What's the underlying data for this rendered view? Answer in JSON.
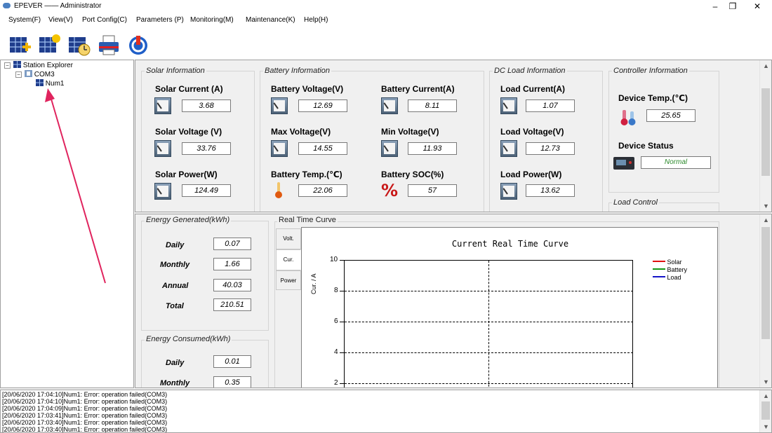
{
  "window": {
    "title": "EPEVER —— Administrator",
    "minimize": "–",
    "restore": "❐",
    "close": "✕"
  },
  "menu": [
    "System(F)",
    "View(V)",
    "Port Config(C)",
    "Parameters (P)",
    "Monitoring(M)",
    "Maintenance(K)",
    "Help(H)"
  ],
  "toolbar": {
    "icons": [
      "add-station-icon",
      "solar-panel-icon",
      "schedule-icon",
      "printer-icon",
      "power-icon"
    ]
  },
  "tree": {
    "root": "Station Explorer",
    "port": "COM3",
    "device": "Num1"
  },
  "solar": {
    "title": "Solar Information",
    "current_label": "Solar Current (A)",
    "current": "3.68",
    "voltage_label": "Solar Voltage (V)",
    "voltage": "33.76",
    "power_label": "Solar Power(W)",
    "power": "124.49"
  },
  "battery": {
    "title": "Battery Information",
    "voltage_label": "Battery Voltage(V)",
    "voltage": "12.69",
    "current_label": "Battery Current(A)",
    "current": "8.11",
    "max_label": "Max Voltage(V)",
    "max": "14.55",
    "min_label": "Min Voltage(V)",
    "min": "11.93",
    "temp_label": "Battery Temp.(℃)",
    "temp": "22.06",
    "soc_label": "Battery SOC(%)",
    "soc": "57"
  },
  "load": {
    "title": "DC Load Information",
    "current_label": "Load Current(A)",
    "current": "1.07",
    "voltage_label": "Load Voltage(V)",
    "voltage": "12.73",
    "power_label": "Load Power(W)",
    "power": "13.62"
  },
  "controller": {
    "title": "Controller Information",
    "temp_label": "Device Temp.(℃)",
    "temp": "25.65",
    "status_label": "Device Status",
    "status": "Normal",
    "status_color": "#2e8b2e",
    "load_control_title": "Load Control"
  },
  "energy_generated": {
    "title": "Energy Generated(kWh)",
    "rows": [
      {
        "label": "Daily",
        "value": "0.07"
      },
      {
        "label": "Monthly",
        "value": "1.66"
      },
      {
        "label": "Annual",
        "value": "40.03"
      },
      {
        "label": "Total",
        "value": "210.51"
      }
    ]
  },
  "energy_consumed": {
    "title": "Energy Consumed(kWh)",
    "rows": [
      {
        "label": "Daily",
        "value": "0.01"
      },
      {
        "label": "Monthly",
        "value": "0.35"
      }
    ]
  },
  "curve": {
    "group_title": "Real Time Curve",
    "tabs": [
      "Volt.",
      "Cur.",
      "Power"
    ],
    "active_tab": "Cur.",
    "chart_title": "Current Real Time Curve",
    "ylabel": "Cur. / A",
    "yticks": [
      "10",
      "8",
      "6",
      "4",
      "2"
    ],
    "legend": [
      {
        "name": "Solar",
        "color": "#e01010"
      },
      {
        "name": "Battery",
        "color": "#149614"
      },
      {
        "name": "Load",
        "color": "#1414c8"
      }
    ]
  },
  "log": [
    "[20/06/2020 17:04:10]Num1: Error: operation failed(COM3)",
    "[20/06/2020 17:04:10]Num1: Error: operation failed(COM3)",
    "[20/06/2020 17:04:09]Num1: Error: operation failed(COM3)",
    "[20/06/2020 17:03:41]Num1: Error: operation failed(COM3)",
    "[20/06/2020 17:03:40]Num1: Error: operation failed(COM3)",
    "[20/06/2020 17:03:40]Num1: Error: operation failed(COM3)"
  ],
  "annotation": {
    "arrow_color": "#e0245e"
  }
}
